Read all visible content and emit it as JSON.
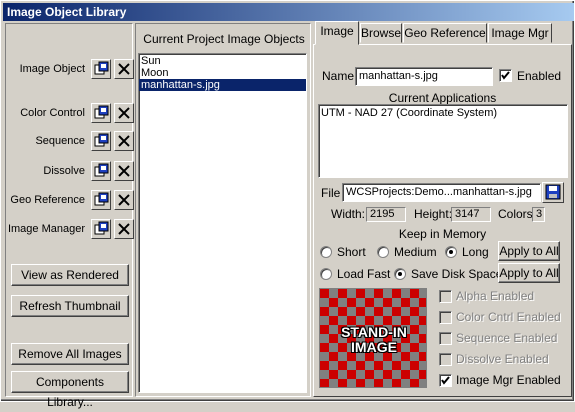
{
  "window": {
    "title": "Image Object Library"
  },
  "left": {
    "rows": [
      {
        "label": "Image Object"
      },
      {
        "label": "Color Control"
      },
      {
        "label": "Sequence"
      },
      {
        "label": "Dissolve"
      },
      {
        "label": "Geo Reference"
      },
      {
        "label": "Image Manager"
      }
    ],
    "buttons": {
      "view_as_rendered": "View as Rendered",
      "refresh_thumbnail": "Refresh Thumbnail",
      "remove_all": "Remove All Images",
      "components_library": "Components Library..."
    }
  },
  "objects": {
    "header": "Current Project Image Objects",
    "items": [
      "Sun",
      "Moon",
      "manhattan-s.jpg"
    ],
    "selected_index": 2
  },
  "tabs": [
    "Image",
    "Browse",
    "Geo Reference",
    "Image Mgr"
  ],
  "active_tab": "Image",
  "image": {
    "name_label": "Name",
    "name_value": "manhattan-s.jpg",
    "enabled_label": "Enabled",
    "enabled_checked": true,
    "apps_header": "Current Applications",
    "apps": [
      "UTM - NAD 27 (Coordinate System)"
    ],
    "file_label": "File",
    "file_value": "WCSProjects:Demo...manhattan-s.jpg",
    "width_label": "Width:",
    "width_value": "2195",
    "height_label": "Height:",
    "height_value": "3147",
    "colors_label": "Colors:",
    "colors_value": "3",
    "keep_header": "Keep in Memory",
    "memory_options": [
      "Short",
      "Medium",
      "Long"
    ],
    "memory_selected": "Long",
    "apply_all_1": "Apply to All",
    "load_options": [
      "Load Fast",
      "Save Disk Space"
    ],
    "load_selected": "Save Disk Space",
    "apply_all_2": "Apply to All",
    "thumb_text_line1": "STAND-IN",
    "thumb_text_line2": "IMAGE",
    "flags": [
      {
        "label": "Alpha Enabled",
        "checked": false,
        "enabled": false
      },
      {
        "label": "Color Cntrl Enabled",
        "checked": false,
        "enabled": false
      },
      {
        "label": "Sequence Enabled",
        "checked": false,
        "enabled": false
      },
      {
        "label": "Dissolve Enabled",
        "checked": false,
        "enabled": false
      },
      {
        "label": "Image Mgr Enabled",
        "checked": true,
        "enabled": true
      }
    ]
  },
  "colors": {
    "title_start": "#0a246a",
    "title_end": "#a6caf0",
    "selection": "#0a246a",
    "checker_red": "#cc0000",
    "checker_gray": "#808080"
  }
}
